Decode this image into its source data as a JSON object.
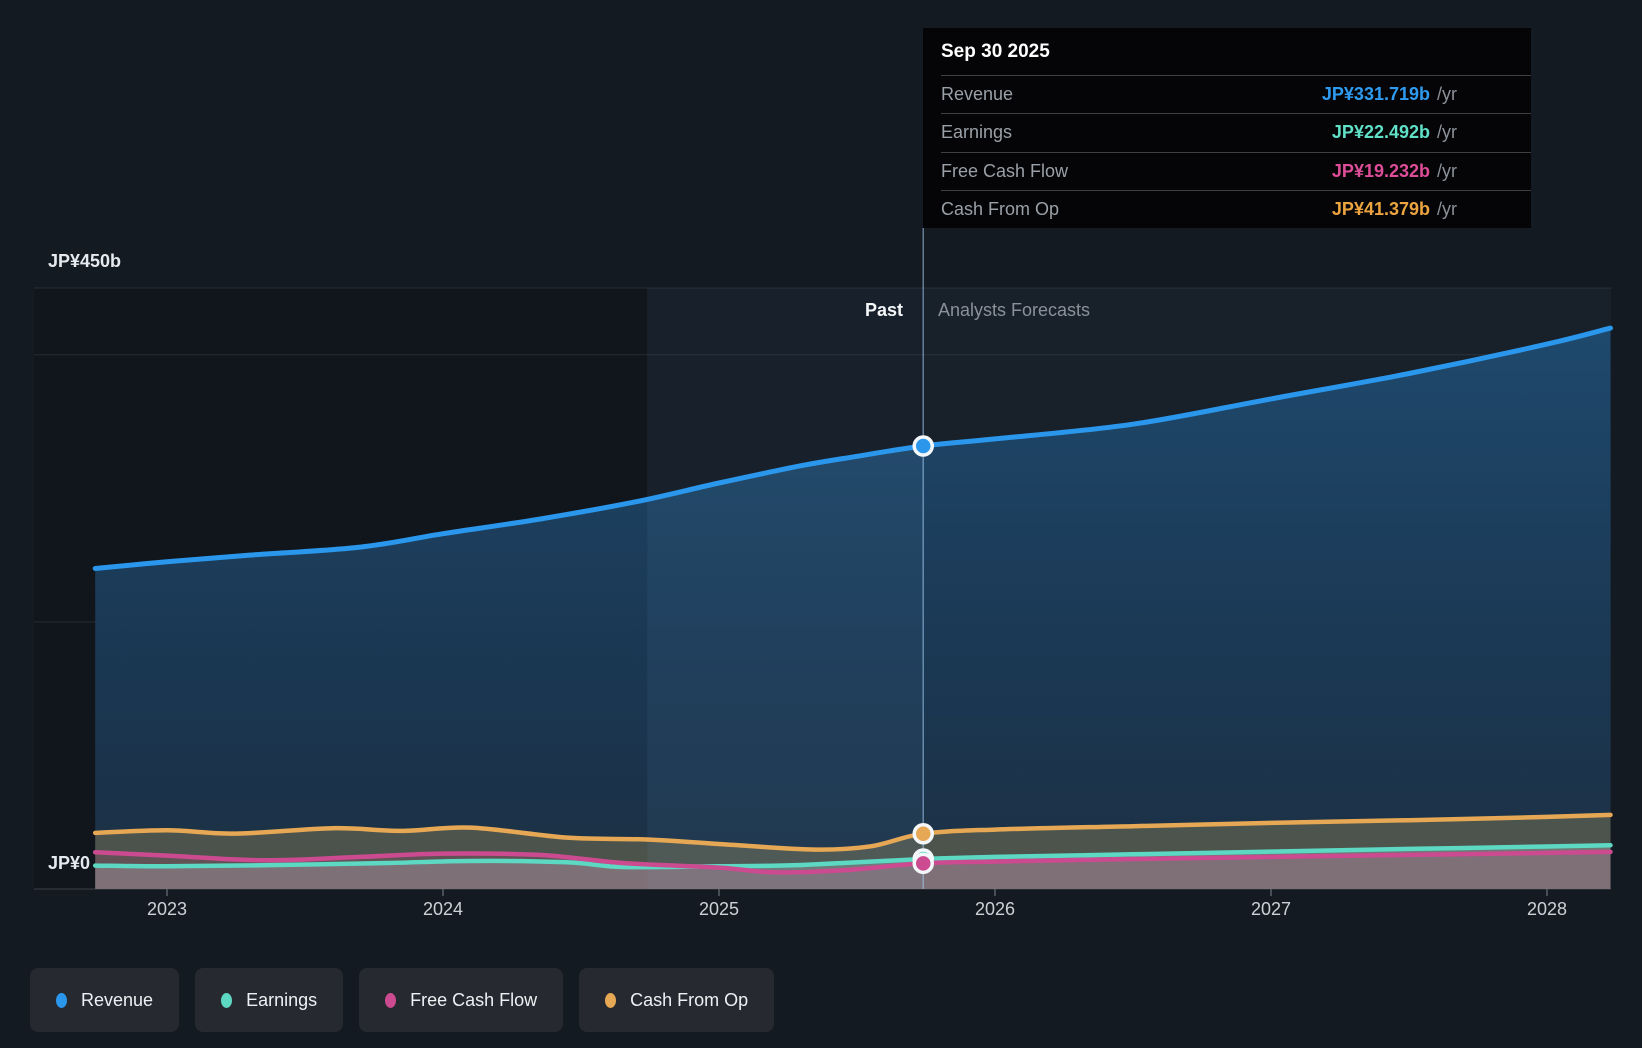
{
  "tooltip": {
    "title": "Sep 30 2025",
    "rows": [
      {
        "label": "Revenue",
        "value": "JP¥331.719b",
        "unit": "/yr",
        "color": "#2e9bf0"
      },
      {
        "label": "Earnings",
        "value": "JP¥22.492b",
        "unit": "/yr",
        "color": "#5fe0c7"
      },
      {
        "label": "Free Cash Flow",
        "value": "JP¥19.232b",
        "unit": "/yr",
        "color": "#de4d98"
      },
      {
        "label": "Cash From Op",
        "value": "JP¥41.379b",
        "unit": "/yr",
        "color": "#eba43f"
      }
    ]
  },
  "chart": {
    "past_label": "Past",
    "forecast_label": "Analysts Forecasts",
    "y_axis": {
      "max_label": "JP¥450b",
      "zero_label": "JP¥0"
    }
  },
  "legend": {
    "items": [
      {
        "label": "Revenue",
        "color": "#2a97ec"
      },
      {
        "label": "Earnings",
        "color": "#5cd8c3"
      },
      {
        "label": "Free Cash Flow",
        "color": "#cc4b90"
      },
      {
        "label": "Cash From Op",
        "color": "#e6a854"
      }
    ]
  },
  "chart_data": {
    "type": "area",
    "title": "Past and future earnings per year (JP¥ billions)",
    "x_axis": {
      "ticks": [
        "2023",
        "2024",
        "2025",
        "2026",
        "2027",
        "2028"
      ]
    },
    "x_domain": [
      2022.74,
      2028.23
    ],
    "y_domain": [
      0,
      450
    ],
    "y_unit": "JP¥ billions per year",
    "y_gridlines": [
      450,
      400,
      200,
      0
    ],
    "divider": {
      "x_year": 2025.74,
      "date": "Sep 30 2025",
      "past_region_highlight_years": 1
    },
    "legend_position": "bottom",
    "series": [
      {
        "name": "Revenue",
        "color": "#2a97ec",
        "fill": "gradient-blue",
        "line_width": 5,
        "marker_value": 331.719,
        "points": [
          [
            2022.74,
            240
          ],
          [
            2023.0,
            245
          ],
          [
            2023.3,
            250
          ],
          [
            2023.7,
            256
          ],
          [
            2024.0,
            266
          ],
          [
            2024.35,
            277
          ],
          [
            2024.7,
            290
          ],
          [
            2025.0,
            304
          ],
          [
            2025.3,
            317
          ],
          [
            2025.5,
            324
          ],
          [
            2025.74,
            331.719
          ],
          [
            2026.0,
            337
          ],
          [
            2026.5,
            348
          ],
          [
            2027.0,
            367
          ],
          [
            2027.5,
            386
          ],
          [
            2028.0,
            408
          ],
          [
            2028.23,
            420
          ]
        ]
      },
      {
        "name": "Cash From Op",
        "color": "#e6a854",
        "fill": "rgba(222,186,97,0.25)",
        "line_width": 4.5,
        "marker_value": 41.379,
        "points": [
          [
            2022.74,
            42
          ],
          [
            2023.0,
            44
          ],
          [
            2023.25,
            41.5
          ],
          [
            2023.6,
            45.5
          ],
          [
            2023.85,
            43.5
          ],
          [
            2024.1,
            46
          ],
          [
            2024.45,
            38.5
          ],
          [
            2024.75,
            37
          ],
          [
            2025.05,
            33
          ],
          [
            2025.35,
            29.5
          ],
          [
            2025.55,
            32
          ],
          [
            2025.74,
            41.379
          ],
          [
            2026.0,
            44.5
          ],
          [
            2026.5,
            47
          ],
          [
            2027.0,
            49.5
          ],
          [
            2027.5,
            51.5
          ],
          [
            2028.0,
            54
          ],
          [
            2028.23,
            55.5
          ]
        ]
      },
      {
        "name": "Earnings",
        "color": "#5cd8c3",
        "fill": "rgba(213,223,233,0.26)",
        "line_width": 4.5,
        "marker_value": 22.492,
        "points": [
          [
            2022.74,
            17.5
          ],
          [
            2023.0,
            17
          ],
          [
            2023.4,
            18
          ],
          [
            2023.8,
            19.5
          ],
          [
            2024.1,
            21
          ],
          [
            2024.45,
            20
          ],
          [
            2024.65,
            16.5
          ],
          [
            2025.0,
            17
          ],
          [
            2025.3,
            18
          ],
          [
            2025.74,
            22.492
          ],
          [
            2026.0,
            24
          ],
          [
            2026.5,
            26
          ],
          [
            2027.0,
            28
          ],
          [
            2027.5,
            30
          ],
          [
            2028.0,
            31.8
          ],
          [
            2028.23,
            32.8
          ]
        ]
      },
      {
        "name": "Free Cash Flow",
        "color": "#cc4b90",
        "fill": "rgba(207,81,144,0.16)",
        "line_width": 4.5,
        "marker_value": 19.232,
        "points": [
          [
            2022.74,
            27.5
          ],
          [
            2023.0,
            25
          ],
          [
            2023.35,
            21.5
          ],
          [
            2023.7,
            24
          ],
          [
            2024.0,
            26.5
          ],
          [
            2024.35,
            25.5
          ],
          [
            2024.65,
            19.5
          ],
          [
            2025.0,
            16
          ],
          [
            2025.2,
            12.5
          ],
          [
            2025.45,
            14
          ],
          [
            2025.74,
            19.232
          ],
          [
            2026.0,
            20.5
          ],
          [
            2026.5,
            22.5
          ],
          [
            2027.0,
            24
          ],
          [
            2027.5,
            25.5
          ],
          [
            2028.0,
            27
          ],
          [
            2028.23,
            27.8
          ]
        ]
      }
    ]
  }
}
